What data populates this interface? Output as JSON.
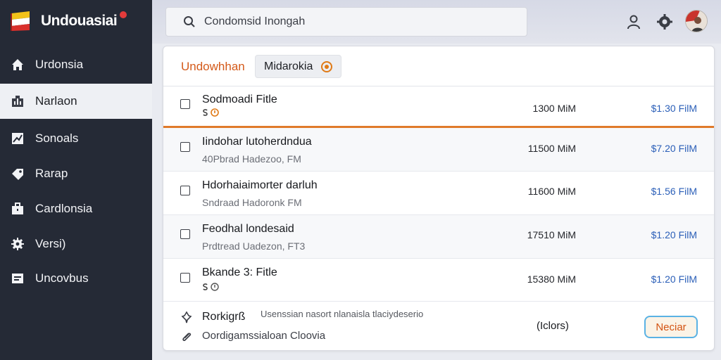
{
  "app": {
    "name": "Undouasiai"
  },
  "search": {
    "placeholder": "Condomsid Inongah"
  },
  "sidebar": {
    "items": [
      {
        "label": "Urdonsia",
        "icon": "home-icon"
      },
      {
        "label": "Narlaon",
        "icon": "building-icon",
        "active": true
      },
      {
        "label": "Sonoals",
        "icon": "chart-icon"
      },
      {
        "label": "Rarap",
        "icon": "tag-icon"
      },
      {
        "label": "Cardlonsia",
        "icon": "briefcase-icon"
      },
      {
        "label": "Versi)",
        "icon": "gear-icon"
      },
      {
        "label": "Uncovbus",
        "icon": "list-icon"
      }
    ]
  },
  "panel": {
    "tab_title": "Undowhhan",
    "chip_label": "Midarokia",
    "rows": [
      {
        "title": "Sodmoadi Fitle",
        "subtitle": "",
        "size": "1300 MiM",
        "price": "$1.30 FilM",
        "icons": true
      },
      {
        "title": "Iindohar lutoherdndua",
        "subtitle": "40Pbrad Hadezoo, FM",
        "size": "11500 MiM",
        "price": "$7.20 FilM",
        "icons": false
      },
      {
        "title": "Hdorhaiaimorter darluh",
        "subtitle": "Sndraad Hadoronk FM",
        "size": "11600 MiM",
        "price": "$1.56 FilM",
        "icons": false
      },
      {
        "title": "Feodhal londesaid",
        "subtitle": "Prdtread Uadezon, FT3",
        "size": "17510 MiM",
        "price": "$1.20 FilM",
        "icons": false
      },
      {
        "title": "Bkande 3: Fitle",
        "subtitle": "",
        "size": "15380 MiM",
        "price": "$1.20 FilM",
        "icons": true
      }
    ],
    "footer": {
      "label": "Rorkigrß",
      "note": "Usenssian nasort nlanaisla tlaciydeserio",
      "line2": "Oordigamssialoan Cloovia",
      "count": "(Iclors)",
      "button": "Neciar"
    }
  },
  "colors": {
    "sidebar": "#252a36",
    "accent": "#d45a1a",
    "link": "#2b5fb8",
    "button_border": "#5ab2e4"
  }
}
